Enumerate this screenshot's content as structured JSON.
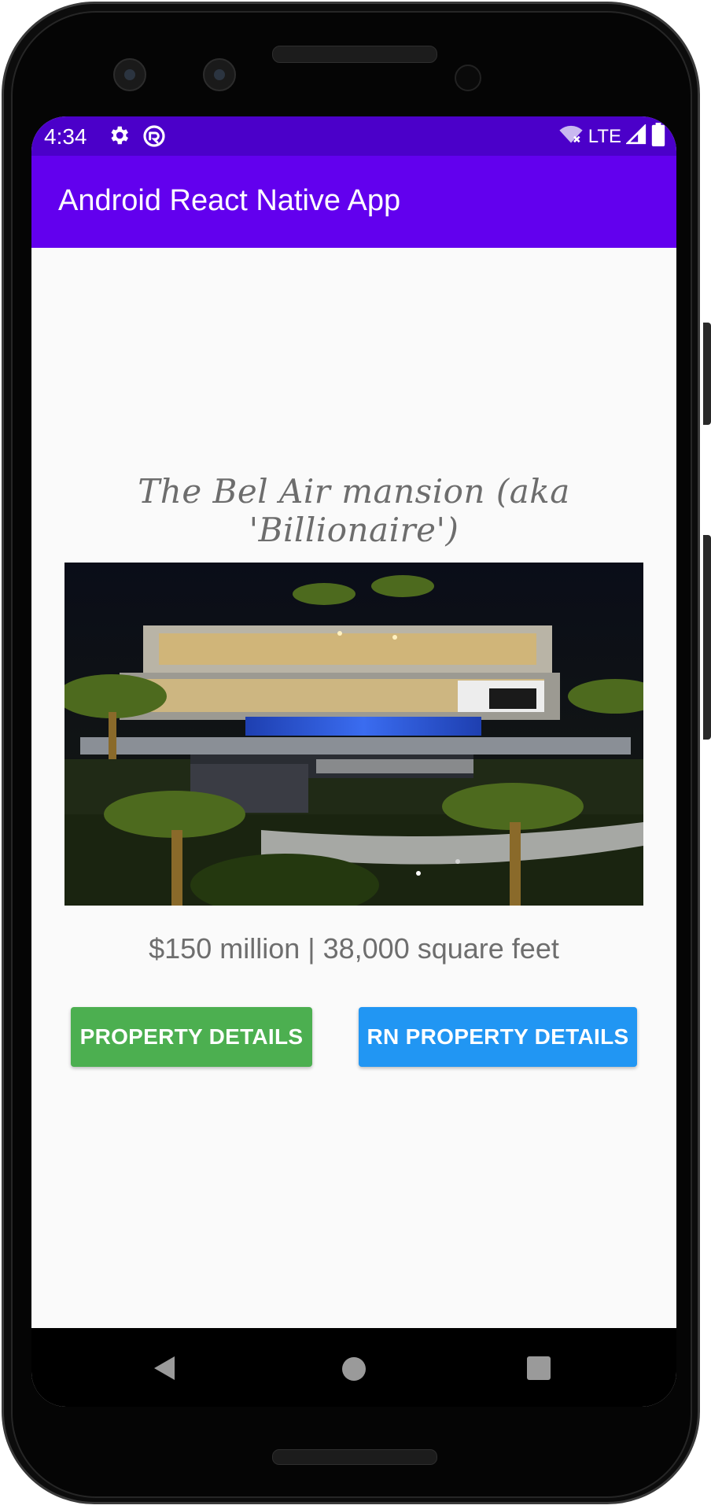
{
  "status_bar": {
    "time": "4:34",
    "network": "LTE",
    "icons": [
      "gear-icon",
      "cast-icon",
      "wifi-off-icon",
      "signal-icon",
      "battery-icon"
    ]
  },
  "app_bar": {
    "title": "Android React Native App"
  },
  "property": {
    "headline": "The Bel Air mansion (aka 'Billionaire')",
    "image_description": "night aerial view of mansion",
    "summary": "$150 million | 38,000 square feet"
  },
  "buttons": {
    "property_details": "PROPERTY DETAILS",
    "rn_property_details": "RN PROPERTY DETAILS"
  },
  "colors": {
    "status_bar": "#4b00c9",
    "app_bar": "#6200ee",
    "green_button": "#4caf50",
    "blue_button": "#2196f3"
  },
  "nav_bar": {
    "icons": [
      "back-icon",
      "home-icon",
      "recents-icon"
    ]
  }
}
